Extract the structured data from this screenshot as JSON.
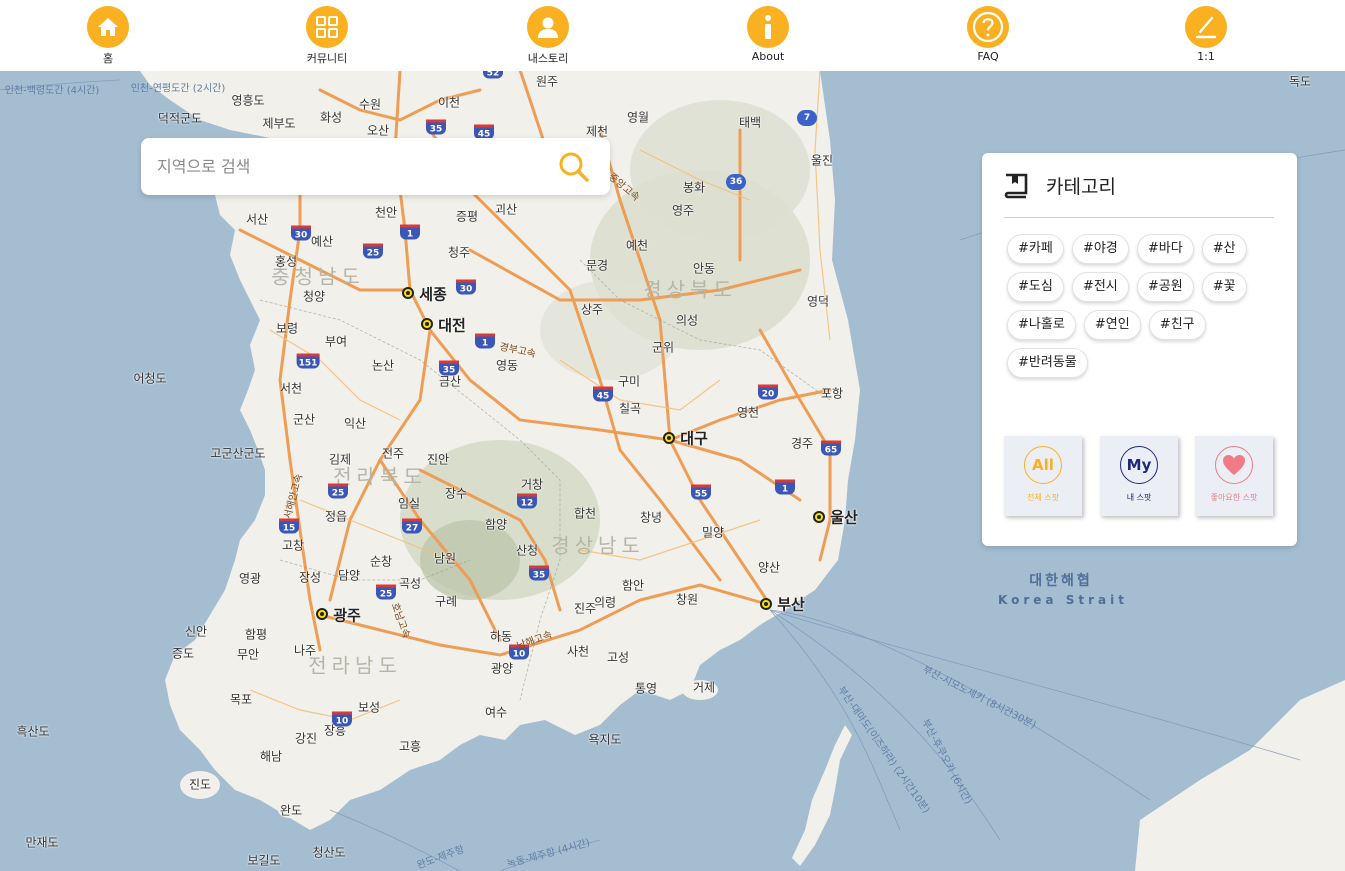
{
  "nav": {
    "items": [
      {
        "label": "홈",
        "icon": "home-icon"
      },
      {
        "label": "커뮤니티",
        "icon": "grid-icon"
      },
      {
        "label": "내스토리",
        "icon": "user-icon"
      },
      {
        "label": "About",
        "icon": "info-icon"
      },
      {
        "label": "FAQ",
        "icon": "question-icon"
      },
      {
        "label": "1:1",
        "icon": "pencil-icon"
      }
    ],
    "accent": "#f9b121"
  },
  "search": {
    "placeholder": "지역으로 검색",
    "icon": "search-icon",
    "icon_color": "#f9b121"
  },
  "category": {
    "title": "카테고리",
    "icon": "book-icon",
    "tags": [
      "#카페",
      "#야경",
      "#바다",
      "#산",
      "#도심",
      "#전시",
      "#공원",
      "#꽃",
      "#나홀로",
      "#연인",
      "#친구",
      "#반려동물"
    ],
    "spots": [
      {
        "badge": "All",
        "label": "전체 스팟",
        "color": "#f9b121"
      },
      {
        "badge": "My",
        "label": "내 스팟",
        "color": "#1e2a78"
      },
      {
        "badge": "heart-icon",
        "label": "좋아요한 스팟",
        "color": "#f07a88"
      }
    ]
  },
  "map": {
    "regions": [
      "충청남도",
      "경상북도",
      "전라북도",
      "경상남도",
      "전라남도"
    ],
    "major_cities": [
      "세종",
      "대전",
      "대구",
      "울산",
      "부산",
      "광주"
    ],
    "cities": [
      "원주",
      "수원",
      "이천",
      "화성",
      "오산",
      "제천",
      "영월",
      "태백",
      "울진",
      "봉화",
      "영주",
      "천안",
      "증평",
      "괴산",
      "청주",
      "서산",
      "예산",
      "홍성",
      "청양",
      "보령",
      "부여",
      "논산",
      "문경",
      "예천",
      "안동",
      "상주",
      "의성",
      "영덕",
      "군위",
      "영동",
      "금산",
      "구미",
      "칠곡",
      "서천",
      "군산",
      "익산",
      "전주",
      "김제",
      "진안",
      "장수",
      "거창",
      "합천",
      "창녕",
      "밀양",
      "영천",
      "경주",
      "포항",
      "정읍",
      "임실",
      "함양",
      "산청",
      "의령",
      "함안",
      "고창",
      "남원",
      "순창",
      "담양",
      "곡성",
      "구례",
      "하동",
      "진주",
      "사천",
      "고성",
      "통영",
      "거제",
      "창원",
      "양산",
      "영광",
      "장성",
      "함평",
      "무안",
      "신안",
      "나주",
      "목포",
      "광양",
      "여수",
      "보성",
      "장흥",
      "강진",
      "고흥",
      "해남",
      "진도",
      "완도",
      "흑산도",
      "만재도",
      "어청도",
      "고군산군도",
      "덕적군도",
      "영흥도",
      "제부도",
      "독도",
      "증도",
      "욕지도",
      "청산도",
      "보길도"
    ],
    "sea": {
      "korean": "대한해협",
      "english": "Korea Strait"
    },
    "ferry_routes": [
      "부산-시모노세키 (8시간30분)",
      "부산-대마도(이즈하라) (2시간10분)",
      "부산-후쿠오카 (6시간)",
      "완도-제주항",
      "녹동-제주항 (4시간)",
      "인천-백령도간 (4시간)",
      "인천-연평도간 (2시간)"
    ],
    "road_names": [
      "경부고속",
      "남해고속",
      "서해안고속",
      "호남고속",
      "중앙고속"
    ],
    "highway_numbers": [
      "30",
      "1",
      "25",
      "151",
      "35",
      "45",
      "20",
      "65",
      "55",
      "12",
      "27",
      "15",
      "10",
      "7",
      "36",
      "52"
    ]
  }
}
